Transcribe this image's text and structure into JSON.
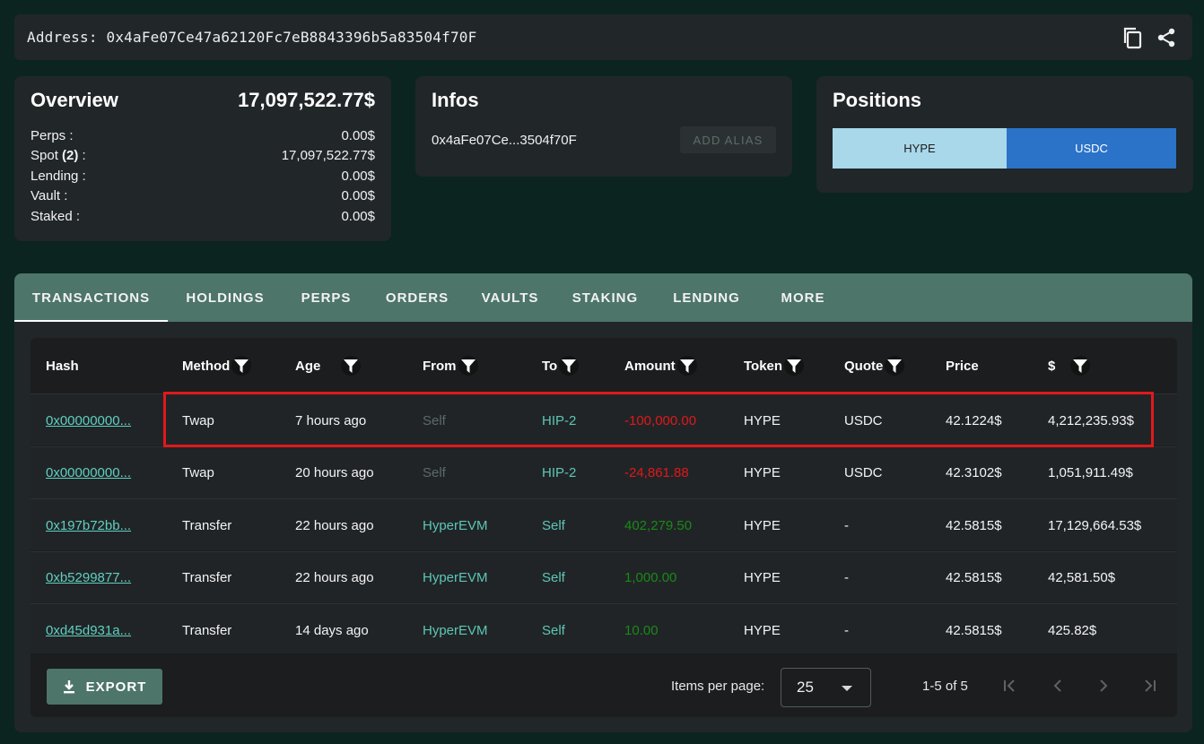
{
  "address_bar": {
    "text": "Address: 0x4aFe07Ce47a62120Fc7eB8843396b5a83504f70F",
    "icons": [
      "copy-icon",
      "share-icon"
    ]
  },
  "overview": {
    "title": "Overview",
    "total": "17,097,522.77$",
    "rows": [
      {
        "label": "Perps :",
        "value": "0.00$"
      },
      {
        "label_prefix": "Spot ",
        "label_bold": "(2)",
        "label_suffix": " :",
        "value": "17,097,522.77$"
      },
      {
        "label": "Lending :",
        "value": "0.00$"
      },
      {
        "label": "Vault :",
        "value": "0.00$"
      },
      {
        "label": "Staked :",
        "value": "0.00$"
      }
    ]
  },
  "infos": {
    "title": "Infos",
    "short_address": "0x4aFe07Ce...3504f70F",
    "alias_button": "ADD ALIAS"
  },
  "positions": {
    "title": "Positions",
    "segments": [
      {
        "label": "HYPE",
        "color": "#a9d8ea"
      },
      {
        "label": "USDC",
        "color": "#2b73c8"
      }
    ]
  },
  "tabs": [
    "TRANSACTIONS",
    "HOLDINGS",
    "PERPS",
    "ORDERS",
    "VAULTS",
    "STAKING",
    "LENDING",
    "MORE"
  ],
  "active_tab": "TRANSACTIONS",
  "table": {
    "columns": [
      "Hash",
      "Method",
      "Age",
      "From",
      "To",
      "Amount",
      "Token",
      "Quote",
      "Price",
      "$"
    ],
    "filterable": [
      "Method",
      "Age",
      "From",
      "To",
      "Amount",
      "Token",
      "Quote",
      "$"
    ],
    "rows": [
      {
        "hash": "0x00000000...",
        "method": "Twap",
        "age": "7 hours ago",
        "from": "Self",
        "to": "HIP-2",
        "amount": "-100,000.00",
        "token": "HYPE",
        "quote": "USDC",
        "price": "42.1224$",
        "usd": "4,212,235.93$"
      },
      {
        "hash": "0x00000000...",
        "method": "Twap",
        "age": "20 hours ago",
        "from": "Self",
        "to": "HIP-2",
        "amount": "-24,861.88",
        "token": "HYPE",
        "quote": "USDC",
        "price": "42.3102$",
        "usd": "1,051,911.49$"
      },
      {
        "hash": "0x197b72bb...",
        "method": "Transfer",
        "age": "22 hours ago",
        "from": "HyperEVM",
        "to": "Self",
        "amount": "402,279.50",
        "token": "HYPE",
        "quote": "-",
        "price": "42.5815$",
        "usd": "17,129,664.53$"
      },
      {
        "hash": "0xb5299877...",
        "method": "Transfer",
        "age": "22 hours ago",
        "from": "HyperEVM",
        "to": "Self",
        "amount": "1,000.00",
        "token": "HYPE",
        "quote": "-",
        "price": "42.5815$",
        "usd": "42,581.50$"
      },
      {
        "hash": "0xd45d931a...",
        "method": "Transfer",
        "age": "14 days ago",
        "from": "HyperEVM",
        "to": "Self",
        "amount": "10.00",
        "token": "HYPE",
        "quote": "-",
        "price": "42.5815$",
        "usd": "425.82$"
      }
    ]
  },
  "footer": {
    "export_label": "EXPORT",
    "items_per_page_label": "Items per page:",
    "items_per_page_value": "25",
    "range_label": "1-5 of 5"
  },
  "colors": {
    "accent": "#4d7569",
    "link": "#5ed0c0",
    "negative": "#e01818",
    "positive": "#178a17",
    "highlight": "#e0191b"
  }
}
